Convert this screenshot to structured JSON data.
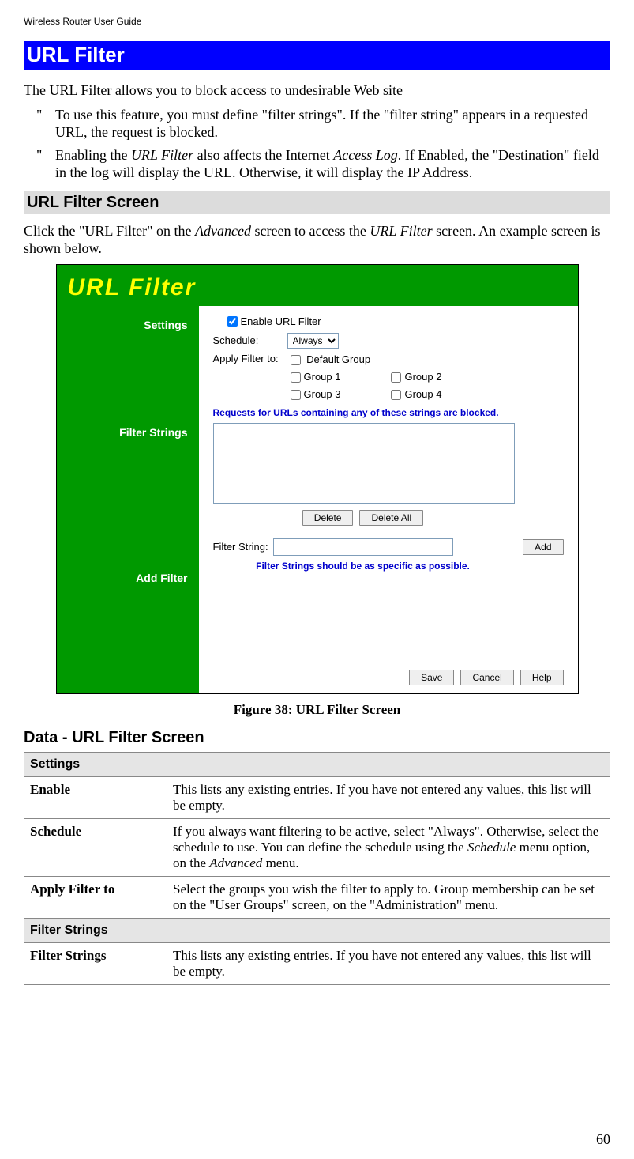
{
  "header": "Wireless Router User Guide",
  "section_title": "URL Filter",
  "intro": "The URL Filter allows you to block access to undesirable Web site",
  "bullets": [
    {
      "pre": "To use this feature, you must define \"filter strings\". If the \"filter string\" appears in a requested URL, the request is blocked."
    },
    {
      "t1": "Enabling the ",
      "i1": "URL Filter",
      "t2": " also affects the Internet ",
      "i2": "Access Log",
      "t3": ". If Enabled, the \"Destination\" field in the log will display the URL. Otherwise, it will display the IP Address."
    }
  ],
  "sub1": "URL Filter Screen",
  "sub1_text": {
    "t1": "Click the \"URL Filter\" on the ",
    "i1": "Advanced",
    "t2": " screen to access the ",
    "i2": "URL Filter",
    "t3": " screen. An example screen is shown below."
  },
  "screenshot": {
    "title": "URL Filter",
    "side": {
      "settings": "Settings",
      "filter": "Filter Strings",
      "add": "Add Filter"
    },
    "settings": {
      "enable_label": "Enable URL Filter",
      "enable_checked": true,
      "schedule_label": "Schedule:",
      "schedule_value": "Always",
      "applyto_label": "Apply Filter to:",
      "groups": [
        "Default Group",
        "Group 1",
        "Group 2",
        "Group 3",
        "Group 4"
      ]
    },
    "filter": {
      "note": "Requests for URLs containing any of these strings are blocked.",
      "delete_btn": "Delete",
      "deleteall_btn": "Delete All"
    },
    "addfilter": {
      "label": "Filter String:",
      "value": "",
      "add_btn": "Add",
      "note": "Filter Strings should be as specific as possible."
    },
    "buttons": {
      "save": "Save",
      "cancel": "Cancel",
      "help": "Help"
    }
  },
  "figure_caption": "Figure 38: URL Filter Screen",
  "data_heading": "Data - URL Filter Screen",
  "table": {
    "sec1": "Settings",
    "rows1": [
      {
        "label": "Enable",
        "desc": "This lists any existing entries. If you have not entered any values, this list will be empty."
      },
      {
        "label": "Schedule",
        "desc_t1": "If you always want filtering to be active, select \"Always\". Otherwise, select the schedule to use. You can define the schedule using the ",
        "desc_i1": "Schedule",
        "desc_t2": " menu option, on the ",
        "desc_i2": "Advanced",
        "desc_t3": " menu."
      },
      {
        "label": "Apply Filter to",
        "desc": "Select the groups you wish the filter to apply to. Group membership can be set on the \"User Groups\" screen, on the \"Administration\" menu."
      }
    ],
    "sec2": "Filter Strings",
    "rows2": [
      {
        "label": "Filter Strings",
        "desc": "This lists any existing entries. If you have not entered any values, this list will be empty."
      }
    ]
  },
  "page_number": "60"
}
